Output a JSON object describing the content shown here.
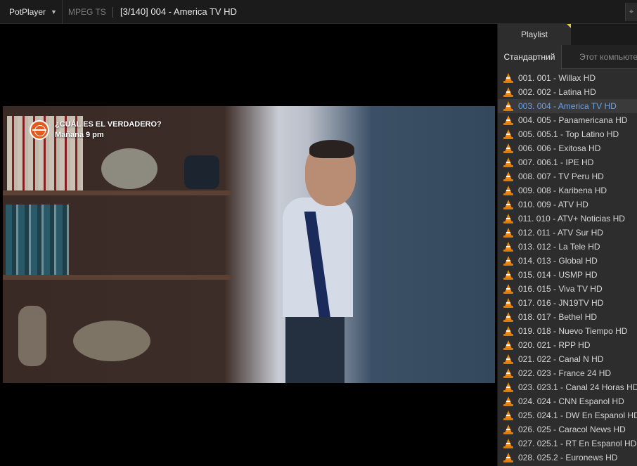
{
  "titlebar": {
    "app_name": "PotPlayer",
    "format": "MPEG TS",
    "title": "[3/140] 004 - America TV HD",
    "corner_icon": "pin-icon"
  },
  "video": {
    "overlay_line1": "¿CUÁL ES EL VERDADERO?",
    "overlay_line2": "Mañana 9 pm",
    "overlay_icon": "globe-logo-icon"
  },
  "playlist": {
    "tab_label": "Playlist",
    "subtab_active": "Стандартний",
    "subtab_inactive": "Этот компьюте",
    "active_index": 2,
    "items": [
      "001. 001 - Willax HD",
      "002. 002 - Latina HD",
      "003. 004 - America TV HD",
      "004. 005 - Panamericana HD",
      "005. 005.1 - Top Latino HD",
      "006. 006 - Exitosa HD",
      "007. 006.1 - IPE HD",
      "008. 007 - TV Peru HD",
      "009. 008 - Karibena HD",
      "010. 009 - ATV HD",
      "011. 010 - ATV+ Noticias HD",
      "012. 011 - ATV Sur HD",
      "013. 012 - La Tele HD",
      "014. 013 - Global HD",
      "015. 014 - USMP HD",
      "016. 015 - Viva TV HD",
      "017. 016 - JN19TV HD",
      "018. 017 - Bethel HD",
      "019. 018 - Nuevo Tiempo HD",
      "020. 021 - RPP HD",
      "021. 022 - Canal N HD",
      "022. 023 - France 24 HD",
      "023. 023.1 - Canal 24 Horas HD",
      "024. 024 - CNN Espanol HD",
      "025. 024.1 - DW En Espanol HD",
      "026. 025 - Caracol News HD",
      "027. 025.1 - RT En Espanol HD",
      "028. 025.2 - Euronews HD"
    ]
  }
}
